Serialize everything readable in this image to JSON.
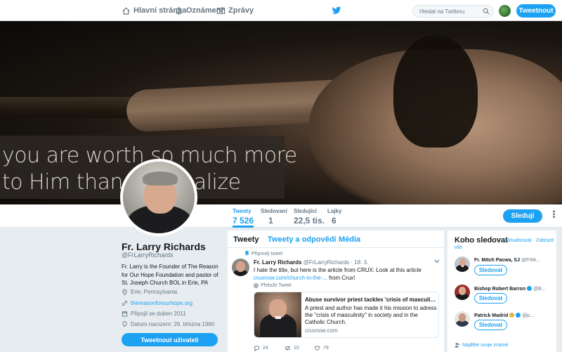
{
  "topbar": {
    "home_label": "Hlavní stránka",
    "notifications_label": "Oznámení",
    "messages_label": "Zprávy",
    "search_placeholder": "Hledat na Twitteru",
    "tweet_button": "Tweetnout"
  },
  "banner": {
    "line1": "you are worth so much more",
    "line2": "to Him than you realize"
  },
  "profile_nav": {
    "stats": [
      {
        "label": "Tweety",
        "value": "7 526"
      },
      {
        "label": "Sledovaní",
        "value": "1"
      },
      {
        "label": "Sledující",
        "value": "22,5 tis."
      },
      {
        "label": "Lajky",
        "value": "6"
      }
    ],
    "follow_button": "Sleduji"
  },
  "profile": {
    "name": "Fr. Larry Richards",
    "handle": "@FrLarryRichards",
    "bio": "Fr. Larry is the Founder of The Reason for Our Hope Foundation and pastor of St. Joseph Church BOL in Erie, PA",
    "location": "Erie, Pennsylvania",
    "website": "thereasonforourhope.org",
    "joined": "Připojil se duben 2011",
    "birthday": "Datum narození: 26. března 1960",
    "tweet_to_button": "Tweetnout uživateli"
  },
  "timeline": {
    "tabs": [
      "Tweety",
      "Tweety a odpovědi",
      "Média"
    ],
    "pinned_label": "Připnutý tweet",
    "tweet": {
      "author": "Fr. Larry Richards",
      "handle": "@FrLarryRichards",
      "date": "· 18. 3.",
      "text": "I hate the title, but here is the article from CRUX: Look at this article",
      "link": "cruxnow.com/church-in-the-...",
      "link_suffix": " from Crux!",
      "translate": "Přeložit Tweet",
      "card": {
        "title": "Abuse survivor priest tackles 'crisis of masculinity'...",
        "description": "A priest and author has made it his mission to adress the \"crisis of masculinity\" in society and in the Catholic Church.",
        "domain": "cruxnow.com"
      },
      "replies": "24",
      "retweets": "10",
      "likes": "79"
    }
  },
  "who_to_follow": {
    "title": "Koho sledovat",
    "refresh": "· Aktualizovat",
    "view_all": "· Zobrazit",
    "view_all_2": "vše",
    "suggestions": [
      {
        "name": "Fr. Mitch Pacwa, SJ",
        "handle": "@FrMi...",
        "button": "Sledovat"
      },
      {
        "name": "Bishop Robert Barron",
        "handle": "@B...",
        "button": "Sledovat"
      },
      {
        "name": "Patrick Madrid",
        "handle": "@p...",
        "button": "Sledovat"
      }
    ],
    "find_friends": "Najděte svoje známé"
  },
  "colors": {
    "accent": "#1da1f2",
    "text": "#14171a",
    "secondary": "#657786",
    "background": "#e6ecf0"
  }
}
